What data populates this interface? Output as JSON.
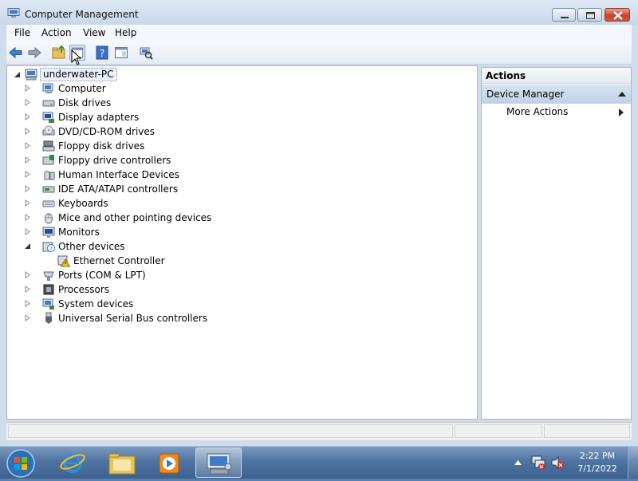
{
  "window": {
    "title": "Computer Management",
    "icon": "computer-management-icon"
  },
  "menu": [
    "File",
    "Action",
    "View",
    "Help"
  ],
  "toolbar": {
    "buttons": [
      "back-arrow-icon",
      "forward-arrow-icon",
      "up-folder-icon",
      "show-hide-console-tree-icon",
      "help-icon",
      "show-hide-action-pane-icon",
      "scan-hardware-icon"
    ]
  },
  "tree": {
    "root": "underwater-PC",
    "nodes": [
      {
        "label": "Computer",
        "icon": "computer-icon"
      },
      {
        "label": "Disk drives",
        "icon": "disk-drive-icon"
      },
      {
        "label": "Display adapters",
        "icon": "display-adapter-icon"
      },
      {
        "label": "DVD/CD-ROM drives",
        "icon": "dvd-drive-icon"
      },
      {
        "label": "Floppy disk drives",
        "icon": "floppy-drive-icon"
      },
      {
        "label": "Floppy drive controllers",
        "icon": "floppy-controller-icon"
      },
      {
        "label": "Human Interface Devices",
        "icon": "hid-icon"
      },
      {
        "label": "IDE ATA/ATAPI controllers",
        "icon": "ide-controller-icon"
      },
      {
        "label": "Keyboards",
        "icon": "keyboard-icon"
      },
      {
        "label": "Mice and other pointing devices",
        "icon": "mouse-icon"
      },
      {
        "label": "Monitors",
        "icon": "monitor-icon"
      },
      {
        "label": "Other devices",
        "icon": "unknown-device-icon",
        "expanded": true,
        "children": [
          {
            "label": "Ethernet Controller",
            "icon": "warning-device-icon"
          }
        ]
      },
      {
        "label": "Ports (COM & LPT)",
        "icon": "port-icon"
      },
      {
        "label": "Processors",
        "icon": "processor-icon"
      },
      {
        "label": "System devices",
        "icon": "system-device-icon"
      },
      {
        "label": "Universal Serial Bus controllers",
        "icon": "usb-icon"
      }
    ]
  },
  "actions": {
    "header": "Actions",
    "section": "Device Manager",
    "items": [
      "More Actions"
    ]
  },
  "taskbar": {
    "buttons": [
      "start-orb-icon",
      "internet-explorer-icon",
      "windows-explorer-icon",
      "media-player-icon",
      "computer-management-task-icon"
    ],
    "tray_icons": [
      "show-hidden-icons-icon",
      "network-icon",
      "volume-muted-icon"
    ],
    "time": "2:22 PM",
    "date": "7/1/2022"
  }
}
